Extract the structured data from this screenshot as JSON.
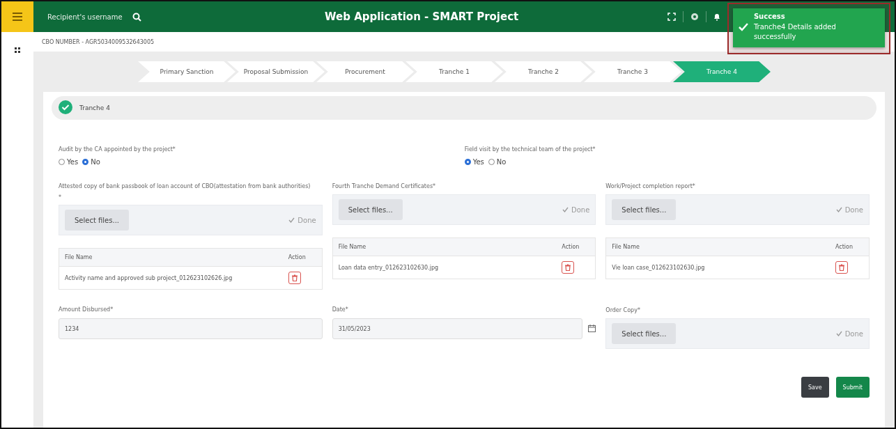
{
  "topbar": {
    "search": {
      "placeholder": "Recipient's username"
    },
    "title": "Web Application - SMART Project"
  },
  "toast": {
    "title": "Success",
    "message": "Tranche4 Details added successfully"
  },
  "cbo_number": "CBO NUMBER - AGR5034009532643005",
  "steps": [
    {
      "label": "Primary Sanction",
      "selected": false
    },
    {
      "label": "Proposal Submission",
      "selected": false
    },
    {
      "label": "Procurement",
      "selected": false
    },
    {
      "label": "Tranche 1",
      "selected": false
    },
    {
      "label": "Tranche 2",
      "selected": false
    },
    {
      "label": "Tranche 3",
      "selected": false
    },
    {
      "label": "Tranche 4",
      "selected": true
    }
  ],
  "section": {
    "title": "Tranche 4",
    "completed": true
  },
  "questions": [
    {
      "label": "Audit by the CA appointed by the project*",
      "options": [
        {
          "label": "Yes",
          "selected": false
        },
        {
          "label": "No",
          "selected": true
        }
      ]
    },
    {
      "label": "Field visit by the technical team of the project*",
      "options": [
        {
          "label": "Yes",
          "selected": true
        },
        {
          "label": "No",
          "selected": false
        }
      ]
    }
  ],
  "uploads": [
    {
      "label": "Attested copy of bank passbook of loan account of CBO(attestation from bank authorities)",
      "mark": "*",
      "button": "Select files...",
      "status": "Done",
      "table": {
        "columns": [
          "File Name",
          "Action"
        ],
        "rows": [
          {
            "file_name": "Activity name and approved sub project_012623102626.jpg"
          }
        ]
      }
    },
    {
      "label": "Fourth Tranche Demand Certificates*",
      "button": "Select files...",
      "status": "Done",
      "table": {
        "columns": [
          "File Name",
          "Action"
        ],
        "rows": [
          {
            "file_name": "Loan data entry_012623102630.jpg"
          }
        ]
      }
    },
    {
      "label": "Work/Project completion report*",
      "button": "Select files...",
      "status": "Done",
      "table": {
        "columns": [
          "File Name",
          "Action"
        ],
        "rows": [
          {
            "file_name": "Vie loan case_012623102630.jpg"
          }
        ]
      }
    }
  ],
  "amount": {
    "label": "Amount Disbursed*",
    "value": "1234"
  },
  "date": {
    "label": "Date*",
    "value": "31/05/2023"
  },
  "order_copy": {
    "label": "Order Copy*",
    "button": "Select files...",
    "status": "Done"
  },
  "buttons": [
    {
      "label": "Save",
      "kind": "secondary"
    },
    {
      "label": "Submit",
      "kind": "primary"
    }
  ]
}
